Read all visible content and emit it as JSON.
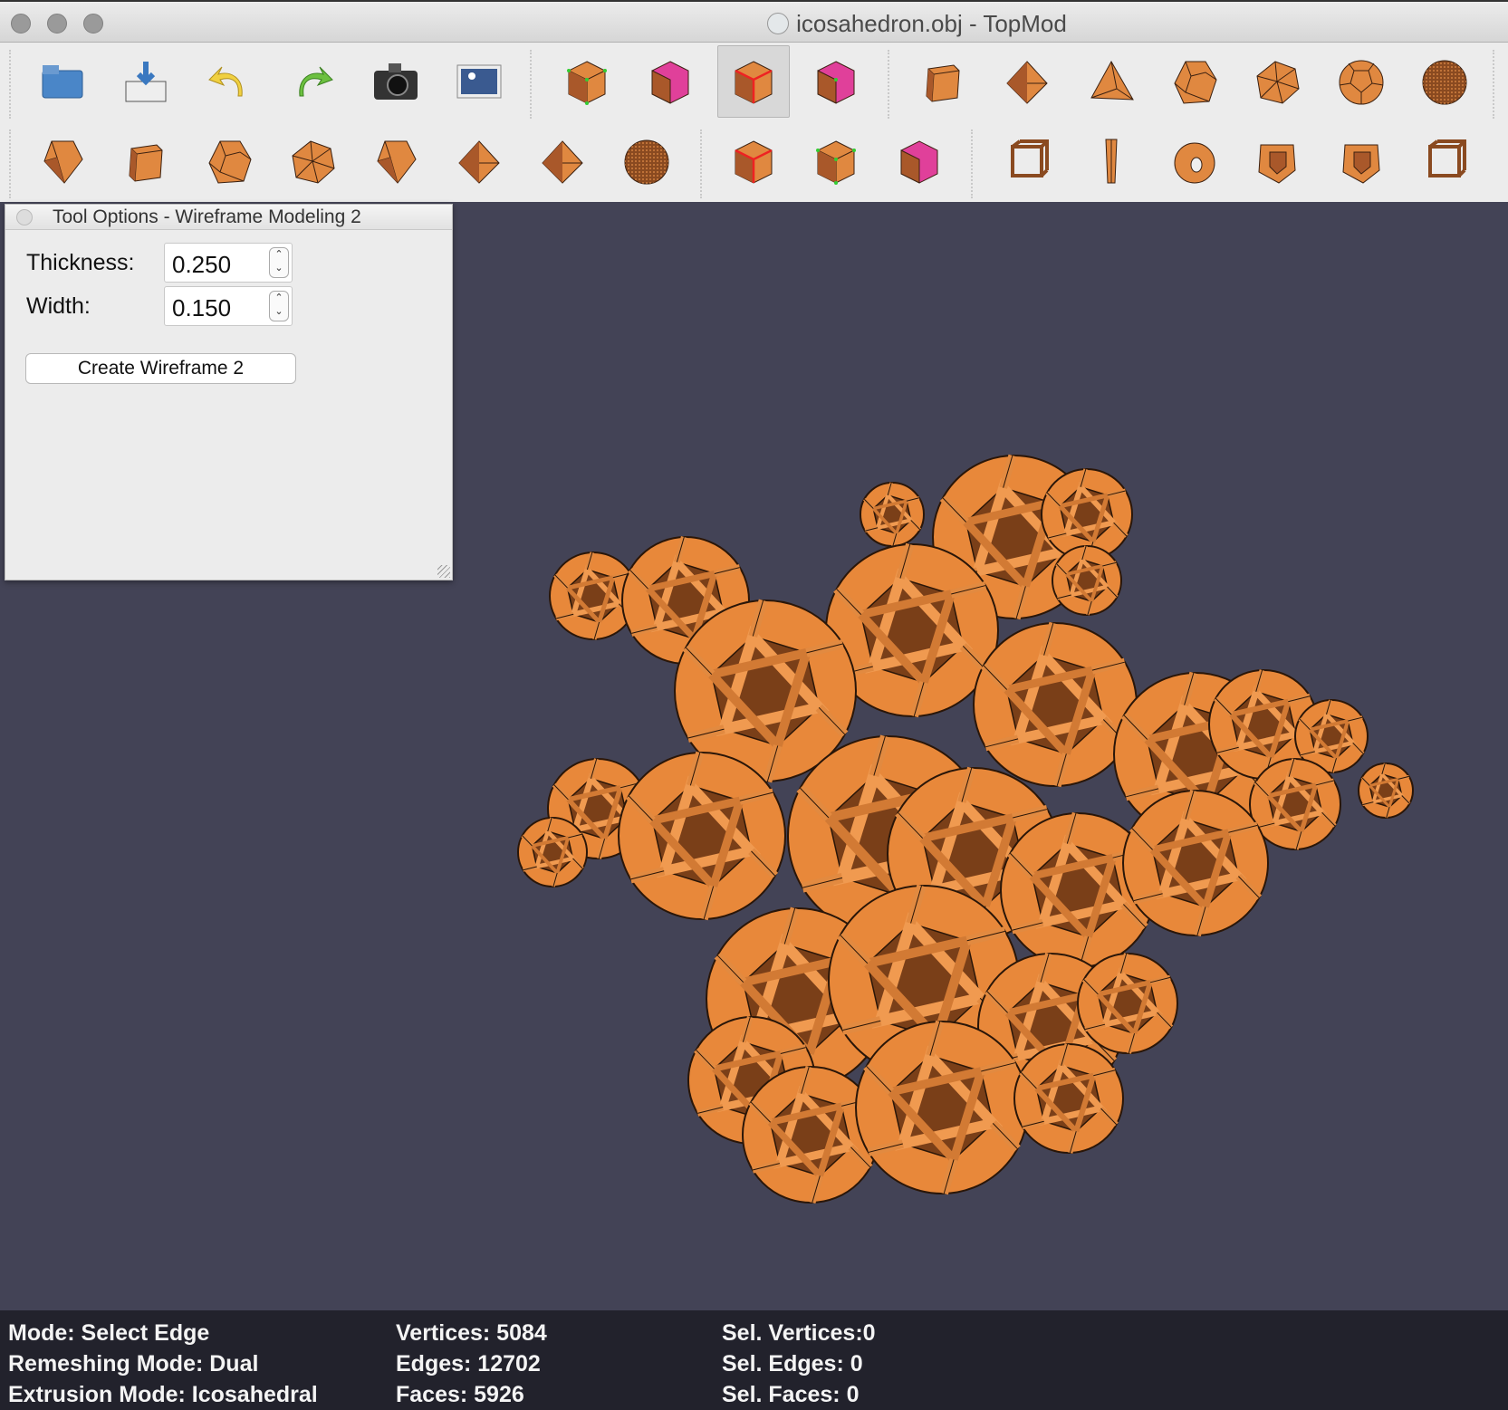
{
  "window": {
    "title": "icosahedron.obj - TopMod"
  },
  "toolbar": {
    "row1": [
      {
        "name": "open-file",
        "icon": "folder-icon"
      },
      {
        "name": "save-file",
        "icon": "save-icon"
      },
      {
        "name": "undo",
        "icon": "undo-icon"
      },
      {
        "name": "redo",
        "icon": "redo-icon"
      },
      {
        "name": "screenshot",
        "icon": "camera-icon"
      },
      {
        "name": "render-image",
        "icon": "image-icon"
      },
      {
        "name": "select-vertex",
        "icon": "cube-vertex-icon"
      },
      {
        "name": "select-face",
        "icon": "cube-face-icon"
      },
      {
        "name": "select-edge",
        "icon": "cube-edge-icon",
        "selected": true
      },
      {
        "name": "select-corner",
        "icon": "cube-corner-icon"
      },
      {
        "name": "cube",
        "icon": "cube-icon"
      },
      {
        "name": "octahedron",
        "icon": "octahedron-icon"
      },
      {
        "name": "tetrahedron",
        "icon": "tetrahedron-icon"
      },
      {
        "name": "dodecahedron",
        "icon": "dodecahedron-icon"
      },
      {
        "name": "icosahedron",
        "icon": "icosahedron-icon"
      },
      {
        "name": "soccer-ball",
        "icon": "soccerball-icon"
      },
      {
        "name": "geodesic-sphere",
        "icon": "sphere-icon"
      }
    ],
    "row2": [
      {
        "name": "extrude-face",
        "icon": "extrude-icon"
      },
      {
        "name": "extrude-cube",
        "icon": "cube-icon"
      },
      {
        "name": "dodecahedral-extrude",
        "icon": "dodecahedron-icon"
      },
      {
        "name": "icosahedral-extrude",
        "icon": "icosahedron-icon"
      },
      {
        "name": "dome-extrude",
        "icon": "extrude-icon"
      },
      {
        "name": "stellate",
        "icon": "octahedron-icon"
      },
      {
        "name": "double-stellate",
        "icon": "octahedron-icon"
      },
      {
        "name": "subdivide",
        "icon": "sphere-icon"
      },
      {
        "name": "insert-edge",
        "icon": "cube-edge-icon"
      },
      {
        "name": "connect-edges",
        "icon": "cube-vertex-icon"
      },
      {
        "name": "delete-face",
        "icon": "cube-face-icon"
      },
      {
        "name": "wireframe",
        "icon": "wireframe-icon"
      },
      {
        "name": "column",
        "icon": "column-icon"
      },
      {
        "name": "torus",
        "icon": "torus-icon"
      },
      {
        "name": "hole",
        "icon": "hole-icon"
      },
      {
        "name": "frame",
        "icon": "hole-icon"
      },
      {
        "name": "wireframe-2",
        "icon": "wireframe-icon"
      }
    ]
  },
  "tool_options": {
    "title": "Tool Options - Wireframe Modeling 2",
    "thickness_label": "Thickness:",
    "thickness_value": "0.250",
    "width_label": "Width:",
    "width_value": "0.150",
    "button_label": "Create Wireframe 2"
  },
  "status": {
    "mode": "Mode: Select Edge",
    "remeshing": "Remeshing Mode: Dual",
    "extrusion": "Extrusion Mode: Icosahedral",
    "vertices": "Vertices: 5084",
    "edges": "Edges: 12702",
    "faces": "Faces: 5926",
    "sel_vertices": "Sel. Vertices:0",
    "sel_edges": "Sel. Edges: 0",
    "sel_faces": "Sel. Faces: 0"
  },
  "colors": {
    "model": "#e8883a",
    "viewport": "#434356",
    "statusbar": "#22222c"
  }
}
